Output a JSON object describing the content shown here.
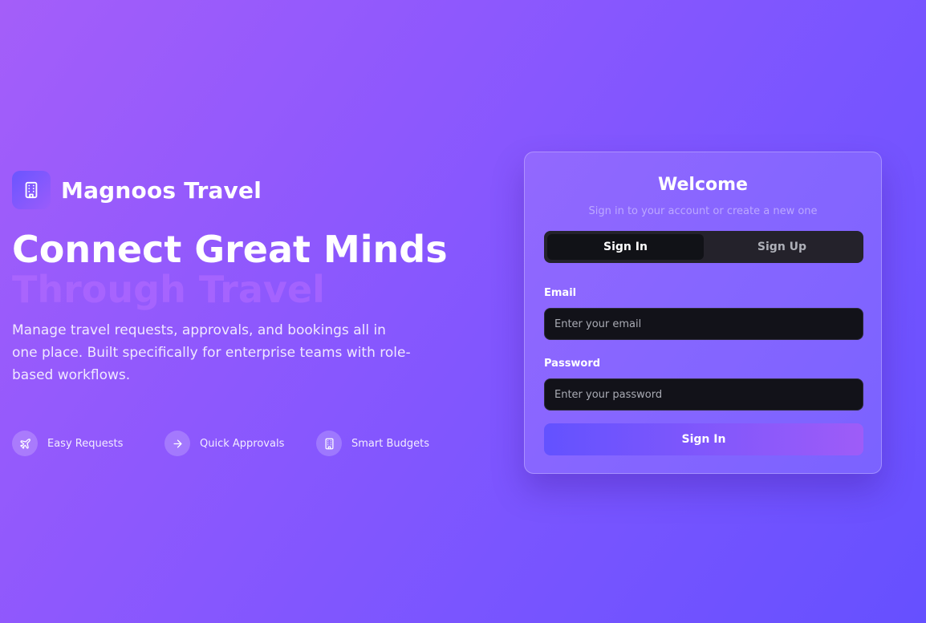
{
  "brand": {
    "name": "Magnoos Travel",
    "icon": "building-icon"
  },
  "hero": {
    "line1": "Connect Great Minds",
    "line2": "Through Travel",
    "description": "Manage travel requests, approvals, and bookings all in one place. Built specifically for enterprise teams with role-based workflows."
  },
  "features": [
    {
      "label": "Easy Requests",
      "icon": "plane-icon"
    },
    {
      "label": "Quick Approvals",
      "icon": "arrow-right-icon"
    },
    {
      "label": "Smart Budgets",
      "icon": "building-icon"
    }
  ],
  "auth": {
    "title": "Welcome",
    "subtitle": "Sign in to your account or create a new one",
    "tabs": {
      "signin": "Sign In",
      "signup": "Sign Up",
      "active": "signin"
    },
    "email": {
      "label": "Email",
      "placeholder": "Enter your email",
      "value": ""
    },
    "password": {
      "label": "Password",
      "placeholder": "Enter your password",
      "value": ""
    },
    "submit": "Sign In"
  },
  "colors": {
    "background_start": "#a45ef9",
    "background_end": "#6650ff",
    "button_start": "#6352ff",
    "button_end": "#9e5cf8",
    "input_bg": "#121219",
    "tabs_bg": "#24222b"
  }
}
